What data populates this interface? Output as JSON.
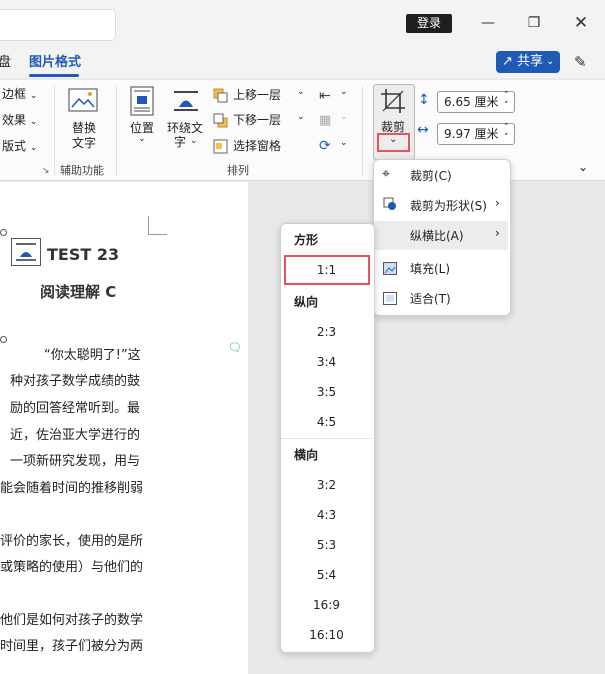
{
  "titlebar": {
    "login_label": "登录"
  },
  "tabs": {
    "partial_label": "盘",
    "picture_format_label": "图片格式",
    "share_label": "共享"
  },
  "ribbon": {
    "border_label": "边框",
    "effect_label": "效果",
    "layout_label": "版式",
    "alt_text_label_1": "替换",
    "alt_text_label_2": "文字",
    "accessibility_group": "辅助功能",
    "position_label": "位置",
    "wrap_text_label_1": "环绕文",
    "wrap_text_label_2": "字",
    "bring_forward_label": "上移一层",
    "send_backward_label": "下移一层",
    "selection_pane_label": "选择窗格",
    "arrange_group": "排列",
    "crop_label": "裁剪",
    "height_value": "6.65 厘米",
    "width_value": "9.97 厘米"
  },
  "document": {
    "heading": "TEST 23",
    "subheading": "阅读理解 C",
    "lines": [
      "“你太聪明了!”这",
      "种对孩子数学成绩的鼓",
      "励的回答经常听到。最",
      "近，佐治亚大学进行的",
      "一项新研究发现，用与",
      "能会随着时间的推移削弱",
      "评价的家长，使用的是所",
      "或策略的使用）与他们的",
      "他们是如何对孩子的数学",
      "时间里，孩子们被分为两"
    ]
  },
  "crop_menu": {
    "items": [
      {
        "label": "裁剪(C)"
      },
      {
        "label": "裁剪为形状(S)"
      },
      {
        "label": "纵横比(A)"
      },
      {
        "label": "填充(L)"
      },
      {
        "label": "适合(T)"
      }
    ]
  },
  "ratio_menu": {
    "square_header": "方形",
    "square": [
      "1:1"
    ],
    "portrait_header": "纵向",
    "portrait": [
      "2:3",
      "3:4",
      "3:5",
      "4:5"
    ],
    "landscape_header": "横向",
    "landscape": [
      "3:2",
      "4:3",
      "5:3",
      "5:4",
      "16:9",
      "16:10"
    ]
  },
  "colors": {
    "accent": "#1f5bb5",
    "highlight": "#e2555a"
  }
}
